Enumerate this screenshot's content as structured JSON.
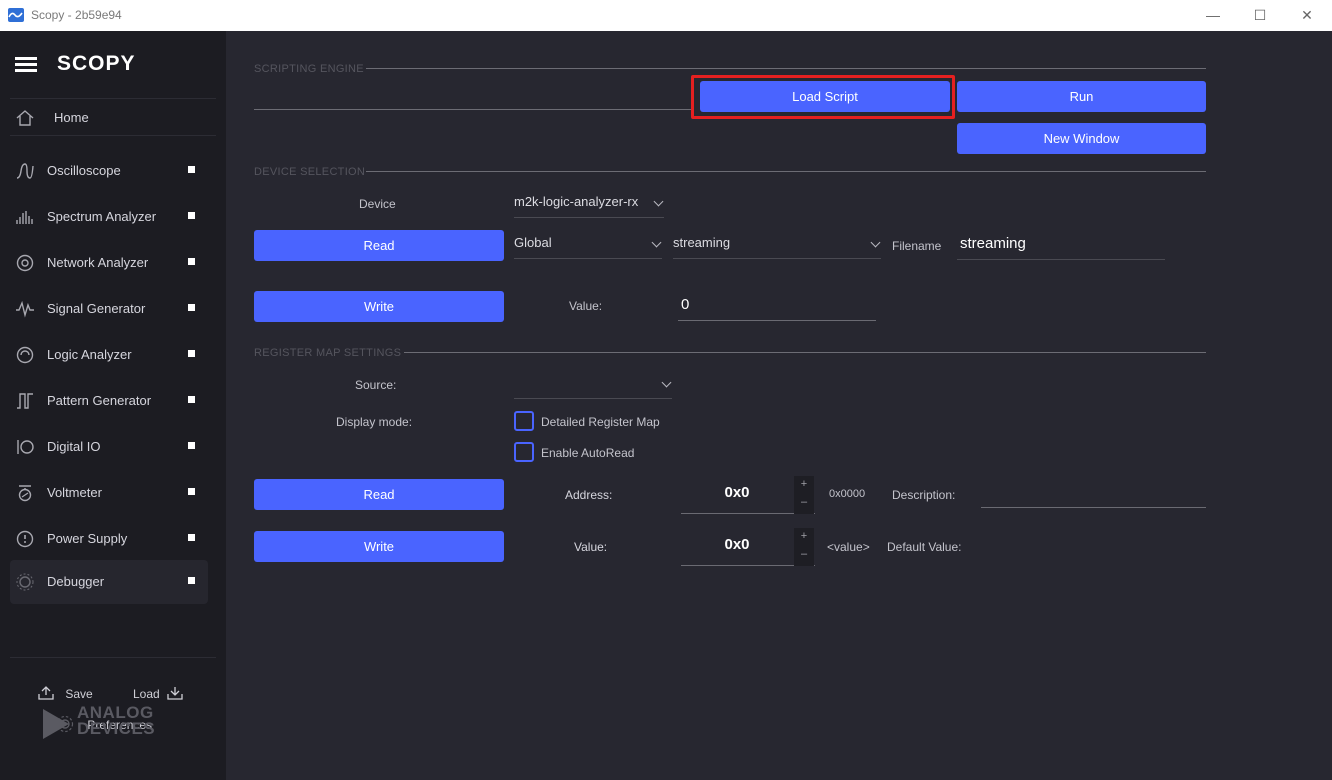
{
  "window": {
    "title": "Scopy - 2b59e94",
    "controls": [
      "—",
      "☐",
      "✕"
    ]
  },
  "sidebar": {
    "logo": "SCOPY",
    "home": {
      "label": "Home",
      "icon": "home-icon"
    },
    "items": [
      {
        "label": "Oscilloscope",
        "icon": "oscilloscope-icon"
      },
      {
        "label": "Spectrum Analyzer",
        "icon": "spectrum-analyzer-icon"
      },
      {
        "label": "Network Analyzer",
        "icon": "network-analyzer-icon"
      },
      {
        "label": "Signal Generator",
        "icon": "signal-generator-icon"
      },
      {
        "label": "Logic Analyzer",
        "icon": "logic-analyzer-icon"
      },
      {
        "label": "Pattern Generator",
        "icon": "pattern-generator-icon"
      },
      {
        "label": "Digital IO",
        "icon": "digital-io-icon"
      },
      {
        "label": "Voltmeter",
        "icon": "voltmeter-icon"
      },
      {
        "label": "Power Supply",
        "icon": "power-supply-icon"
      },
      {
        "label": "Debugger",
        "icon": "debugger-icon"
      }
    ],
    "save_label": "Save",
    "load_label": "Load",
    "preferences_label": "Preferences",
    "brand_line1": "ANALOG",
    "brand_line2": "DEVICES"
  },
  "scripting": {
    "title": "SCRIPTING ENGINE",
    "load_script": "Load Script",
    "run": "Run",
    "new_window": "New Window"
  },
  "device_selection": {
    "title": "DEVICE SELECTION",
    "device_label": "Device",
    "device_value": "m2k-logic-analyzer-rx",
    "read": "Read",
    "write": "Write",
    "scope_value": "Global",
    "attr_value": "streaming",
    "filename_label": "Filename",
    "filename_value": "streaming",
    "value_label": "Value:",
    "value_value": "0"
  },
  "register_map": {
    "title": "REGISTER MAP SETTINGS",
    "source_label": "Source:",
    "source_value": "",
    "display_mode_label": "Display mode:",
    "detailed_map": "Detailed Register Map",
    "enable_autoread": "Enable AutoRead",
    "read": "Read",
    "write": "Write",
    "address_label": "Address:",
    "address_value": "0x0",
    "address_hex": "0x0000",
    "description_label": "Description:",
    "value_label": "Value:",
    "value_value": "0x0",
    "value_placeholder": "<value>",
    "default_value_label": "Default Value:"
  },
  "colors": {
    "accent": "#4a64ff",
    "highlight": "#e52020",
    "background": "#272730",
    "sidebar": "#1c1c22"
  }
}
